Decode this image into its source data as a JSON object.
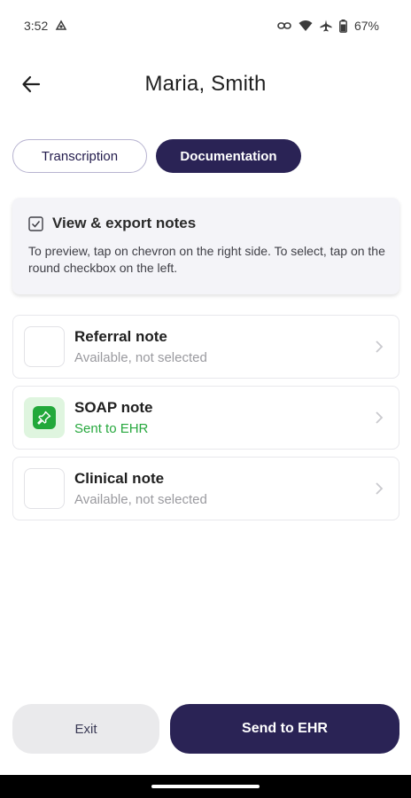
{
  "status_bar": {
    "time": "3:52",
    "battery": "67%",
    "icons": [
      "alarm-icon",
      "link-icon",
      "wifi-icon",
      "airplane-icon",
      "battery-icon"
    ]
  },
  "header": {
    "title": "Maria, Smith",
    "back_icon": "arrow-left-icon"
  },
  "tabs": [
    {
      "label": "Transcription",
      "active": false
    },
    {
      "label": "Documentation",
      "active": true
    }
  ],
  "info_card": {
    "title": "View & export notes",
    "description": "To preview, tap on chevron on the right side. To select, tap on the round checkbox on the left.",
    "icon": "checkbox-icon"
  },
  "notes": [
    {
      "title": "Referral note",
      "status": "Available, not selected",
      "checked": false
    },
    {
      "title": "SOAP note",
      "status": "Sent to EHR",
      "checked": true
    },
    {
      "title": "Clinical note",
      "status": "Available, not selected",
      "checked": false
    }
  ],
  "actions": {
    "exit_label": "Exit",
    "send_label": "Send to EHR"
  },
  "colors": {
    "primary": "#2a2355",
    "success": "#22a83a",
    "muted_text": "#9a9a9f"
  }
}
